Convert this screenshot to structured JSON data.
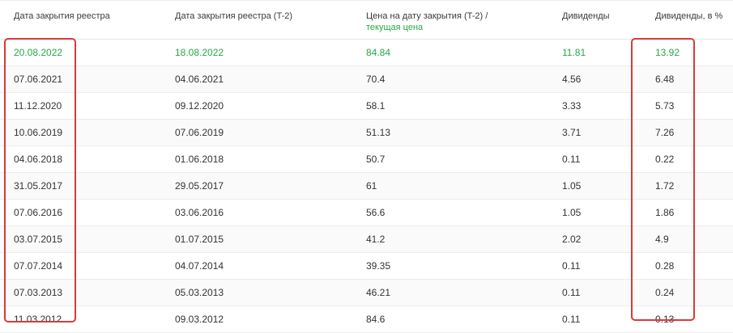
{
  "columns": {
    "close_date": "Дата закрытия реестра",
    "close_date_t2": "Дата закрытия реестра (T-2)",
    "price_line1": "Цена на дату закрытия (T-2) /",
    "price_line2": "текущая цена",
    "dividends": "Дивиденды",
    "dividends_pct": "Дивиденды, в %"
  },
  "rows": [
    {
      "close_date": "20.08.2022",
      "close_date_t2": "18.08.2022",
      "price": "84.84",
      "dividend": "11.81",
      "yield": "13.92"
    },
    {
      "close_date": "07.06.2021",
      "close_date_t2": "04.06.2021",
      "price": "70.4",
      "dividend": "4.56",
      "yield": "6.48"
    },
    {
      "close_date": "11.12.2020",
      "close_date_t2": "09.12.2020",
      "price": "58.1",
      "dividend": "3.33",
      "yield": "5.73"
    },
    {
      "close_date": "10.06.2019",
      "close_date_t2": "07.06.2019",
      "price": "51.13",
      "dividend": "3.71",
      "yield": "7.26"
    },
    {
      "close_date": "04.06.2018",
      "close_date_t2": "01.06.2018",
      "price": "50.7",
      "dividend": "0.11",
      "yield": "0.22"
    },
    {
      "close_date": "31.05.2017",
      "close_date_t2": "29.05.2017",
      "price": "61",
      "dividend": "1.05",
      "yield": "1.72"
    },
    {
      "close_date": "07.06.2016",
      "close_date_t2": "03.06.2016",
      "price": "56.6",
      "dividend": "1.05",
      "yield": "1.86"
    },
    {
      "close_date": "03.07.2015",
      "close_date_t2": "01.07.2015",
      "price": "41.2",
      "dividend": "2.02",
      "yield": "4.9"
    },
    {
      "close_date": "07.07.2014",
      "close_date_t2": "04.07.2014",
      "price": "39.35",
      "dividend": "0.11",
      "yield": "0.28"
    },
    {
      "close_date": "07.03.2013",
      "close_date_t2": "05.03.2013",
      "price": "46.21",
      "dividend": "0.11",
      "yield": "0.24"
    },
    {
      "close_date": "11.03.2012",
      "close_date_t2": "09.03.2012",
      "price": "84.6",
      "dividend": "0.11",
      "yield": "0.13"
    }
  ],
  "colors": {
    "accent_green": "#28a745",
    "annotation_red": "#d63b3b"
  }
}
